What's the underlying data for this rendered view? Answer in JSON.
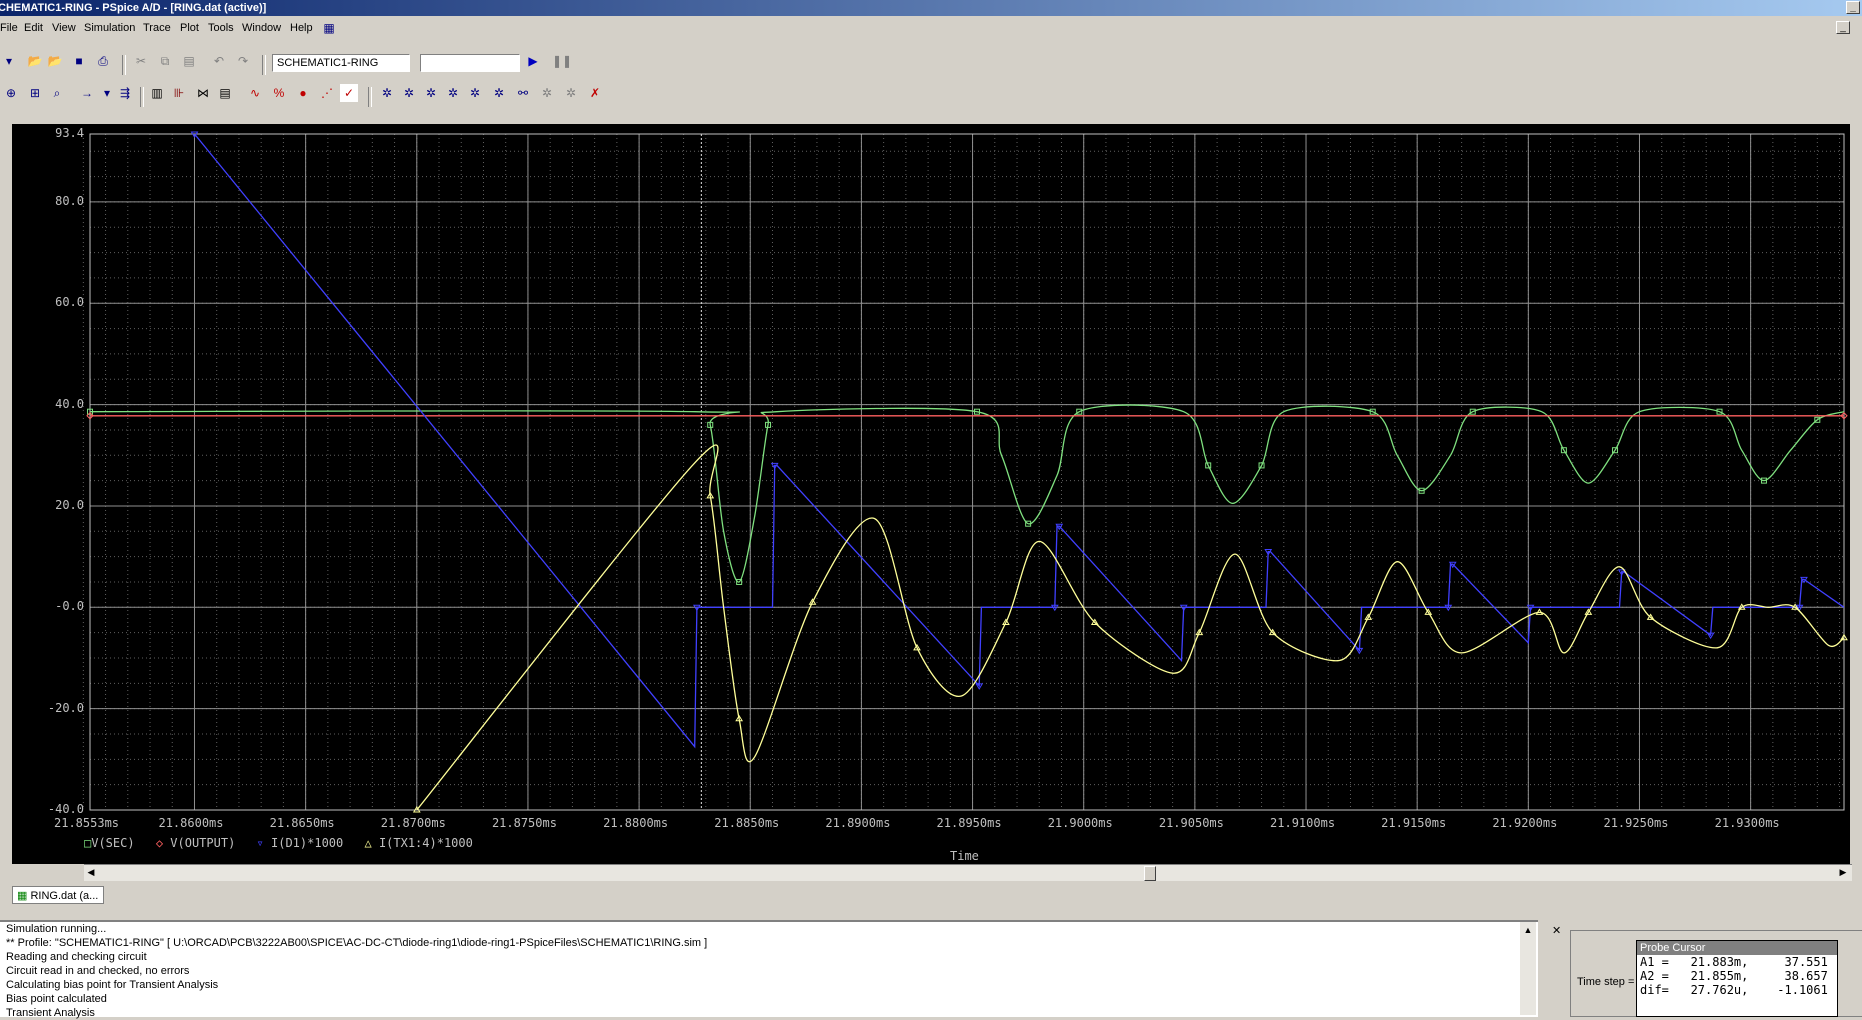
{
  "window": {
    "title": "CHEMATIC1-RING - PSpice A/D - [RING.dat (active)]"
  },
  "menu": [
    "File",
    "Edit",
    "View",
    "Simulation",
    "Trace",
    "Plot",
    "Tools",
    "Window",
    "Help"
  ],
  "toolbar": {
    "profile_combo": "SCHEMATIC1-RING",
    "second_combo": ""
  },
  "chart_data": {
    "type": "line",
    "xlabel": "Time",
    "ylabel": "",
    "x_ticks": [
      "21.8553ms",
      "21.8600ms",
      "21.8650ms",
      "21.8700ms",
      "21.8750ms",
      "21.8800ms",
      "21.8850ms",
      "21.8900ms",
      "21.8950ms",
      "21.9000ms",
      "21.9050ms",
      "21.9100ms",
      "21.9150ms",
      "21.9200ms",
      "21.9250ms",
      "21.9300ms"
    ],
    "y_ticks": [
      "93.4",
      "80.0",
      "60.0",
      "40.0",
      "20.0",
      "-0.0",
      "-20.0",
      "-40.0"
    ],
    "xlim": [
      21.8553,
      21.9342
    ],
    "ylim": [
      -40.0,
      93.4
    ],
    "grid": true,
    "background": "#000000",
    "series": [
      {
        "name": "V(SEC)",
        "color": "#7fe07f",
        "marker": "square",
        "x": [
          21.8553,
          21.8825,
          21.8832,
          21.8838,
          21.8845,
          21.8852,
          21.8858,
          21.8862,
          21.8952,
          21.8963,
          21.8975,
          21.8988,
          21.8998,
          21.9045,
          21.9056,
          21.9067,
          21.908,
          21.909,
          21.913,
          21.9141,
          21.9152,
          21.9165,
          21.9175,
          21.9206,
          21.9216,
          21.9227,
          21.9239,
          21.925,
          21.9286,
          21.9296,
          21.9306,
          21.9318,
          21.933,
          21.9342
        ],
        "y": [
          38.6,
          38.6,
          36,
          15,
          5,
          18,
          36,
          38.6,
          38.6,
          30,
          16.5,
          26,
          38.6,
          38.6,
          28,
          20.5,
          28,
          38.6,
          38.6,
          30,
          23,
          30,
          38.6,
          38.6,
          31,
          24.5,
          31,
          38.6,
          38.6,
          31,
          25,
          31,
          37,
          38.6
        ]
      },
      {
        "name": "V(OUTPUT)",
        "color": "#ff6060",
        "marker": "diamond",
        "x": [
          21.8553,
          21.9342
        ],
        "y": [
          37.8,
          37.8
        ]
      },
      {
        "name": "I(D1)*1000",
        "color": "#4040ff",
        "marker": "triangle-down",
        "x": [
          21.86,
          21.8825,
          21.8826,
          21.886,
          21.8861,
          21.8862,
          21.8953,
          21.8954,
          21.8987,
          21.8988,
          21.8989,
          21.9044,
          21.9045,
          21.9082,
          21.9083,
          21.9084,
          21.9124,
          21.9125,
          21.9164,
          21.9165,
          21.9166,
          21.92,
          21.9201,
          21.9241,
          21.9242,
          21.9243,
          21.9282,
          21.9283,
          21.9322,
          21.9323,
          21.9324,
          21.9342
        ],
        "y": [
          93.4,
          -27.5,
          0,
          0,
          28,
          28,
          -15.5,
          0,
          0,
          16,
          16,
          -10.5,
          0,
          0,
          11,
          11,
          -8.5,
          0,
          0,
          8.5,
          8.5,
          -7,
          0,
          0,
          7,
          7,
          -5.5,
          0,
          0,
          5.5,
          5.5,
          0
        ]
      },
      {
        "name": "I(TX1:4)*1000",
        "color": "#ffff99",
        "marker": "triangle",
        "x": [
          21.87,
          21.8825,
          21.8832,
          21.8838,
          21.8845,
          21.8852,
          21.8878,
          21.8906,
          21.8925,
          21.8945,
          21.8965,
          21.898,
          21.9005,
          21.904,
          21.9052,
          21.9068,
          21.9085,
          21.9115,
          21.9128,
          21.9141,
          21.9155,
          21.917,
          21.9205,
          21.9216,
          21.9227,
          21.9241,
          21.9255,
          21.9285,
          21.9296,
          21.9308,
          21.932,
          21.9335,
          21.9342
        ],
        "y": [
          -40.0,
          28.5,
          22,
          0,
          -22,
          -29.5,
          1,
          17.5,
          -8,
          -17.5,
          -3,
          13,
          -3,
          -13,
          -5,
          10.5,
          -5,
          -10.5,
          -2,
          9,
          -1,
          -9,
          -1,
          -9,
          -1,
          8,
          -2,
          -8,
          0,
          0,
          0,
          -7.5,
          -6
        ]
      }
    ],
    "cursor_x": 21.8828
  },
  "tab": {
    "label": "RING.dat (a..."
  },
  "output": {
    "lines": [
      "Simulation running...",
      "** Profile: \"SCHEMATIC1-RING\"  [ U:\\ORCAD\\PCB\\3222AB00\\SPICE\\AC-DC-CT\\diode-ring1\\diode-ring1-PSpiceFiles\\SCHEMATIC1\\RING.sim ]",
      "Reading and checking circuit",
      "Circuit read in and checked, no errors",
      "Calculating bias point for Transient Analysis",
      "Bias point calculated",
      "Transient Analysis"
    ]
  },
  "probe_cursor": {
    "title": "Probe Cursor",
    "rows": [
      "A1 =   21.883m,     37.551",
      "A2 =   21.855m,     38.657",
      "dif=   27.762u,    -1.1061"
    ],
    "time_step_label": "Time step ="
  }
}
